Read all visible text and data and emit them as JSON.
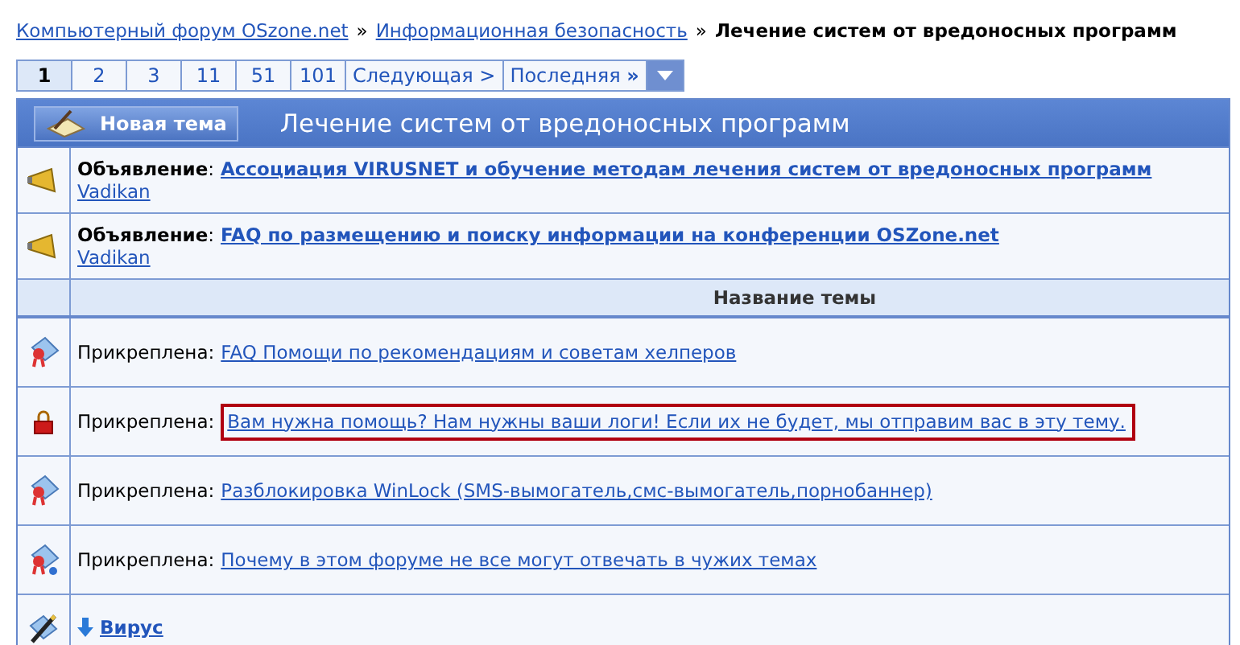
{
  "breadcrumb": {
    "links": [
      "Компьютерный форум OSzone.net",
      "Информационная безопасность"
    ],
    "separator": "»",
    "current": "Лечение систем от вредоносных программ"
  },
  "pager": {
    "pages": [
      {
        "label": "1",
        "selected": true
      },
      {
        "label": "2",
        "selected": false
      },
      {
        "label": "3",
        "selected": false
      },
      {
        "label": "11",
        "selected": false
      },
      {
        "label": "51",
        "selected": false
      },
      {
        "label": "101",
        "selected": false
      }
    ],
    "next": "Следующая >",
    "last": "Последняя",
    "last_mark": "»"
  },
  "forum": {
    "new_topic_button": "Новая тема",
    "title": "Лечение систем от вредоносных программ"
  },
  "announcements": [
    {
      "prefix": "**Объявление**:",
      "title": "Ассоциация VIRUSNET и обучение методам лечения систем от вредоносных программ",
      "author": "Vadikan"
    },
    {
      "prefix": "**Объявление**:",
      "title": "FAQ по размещению и поиску информации на конференции OSZone.net",
      "author": "Vadikan"
    }
  ],
  "column_header": "Название темы",
  "threads": [
    {
      "kind": "sticky",
      "prefix": "Прикреплена:",
      "title": "FAQ Помощи по рекомендациям и советам хелперов",
      "highlighted": false
    },
    {
      "kind": "locked",
      "prefix": "Прикреплена:",
      "title": "Вам нужна помощь? Нам нужны ваши логи! Если их не будет, мы отправим вас в эту тему.",
      "highlighted": true
    },
    {
      "kind": "sticky",
      "prefix": "Прикреплена:",
      "title": "Разблокировка WinLock (SMS-вымогатель,смс-вымогатель,порнобаннер)",
      "highlighted": false
    },
    {
      "kind": "sticky-posted",
      "prefix": "Прикреплена:",
      "title": "Почему в этом форуме не все могут отвечать в чужих темах",
      "highlighted": false
    },
    {
      "kind": "new",
      "title": "Вирус",
      "highlighted": false
    }
  ]
}
